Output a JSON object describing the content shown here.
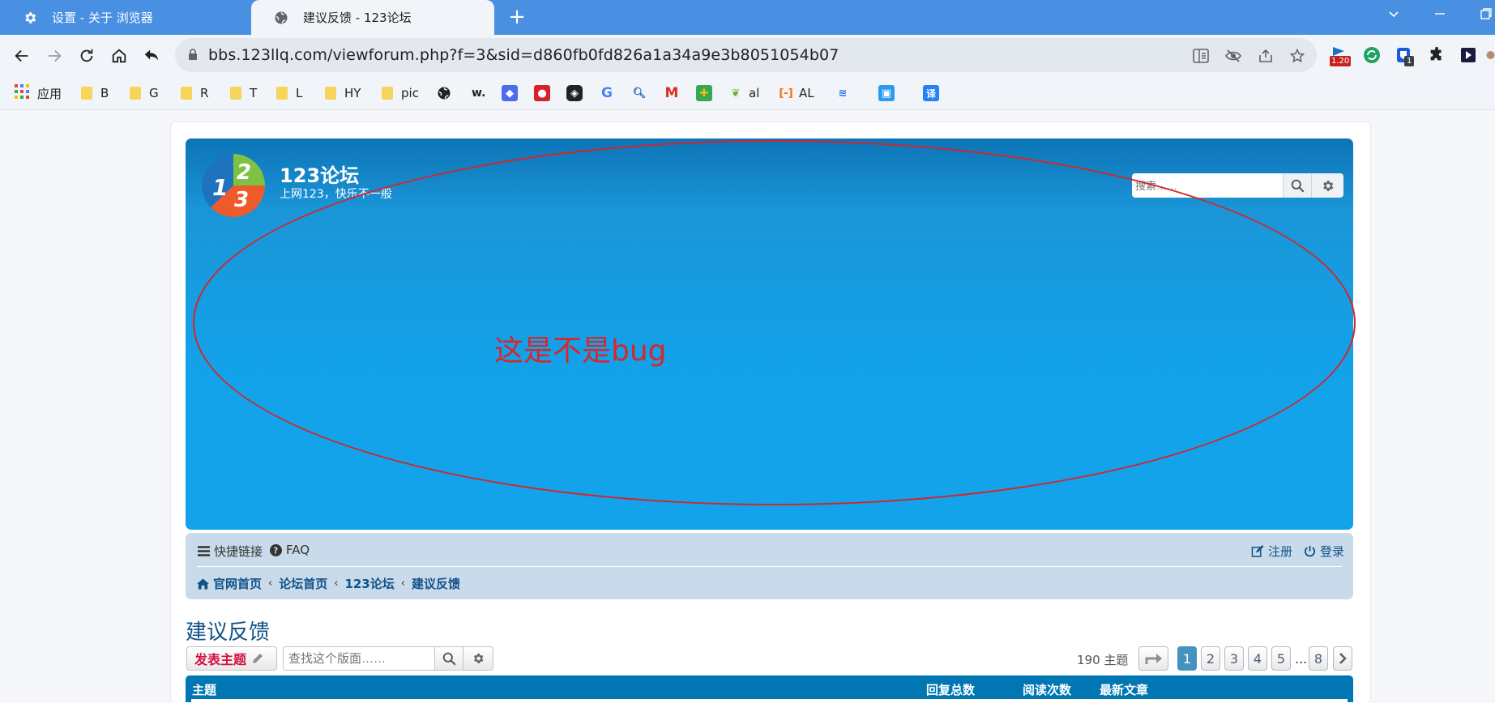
{
  "browser": {
    "tabs": [
      {
        "title": "设置 - 关于 浏览器",
        "icon": "gear-icon",
        "active": false
      },
      {
        "title": "建议反馈 - 123论坛",
        "icon": "globe-icon",
        "active": true
      }
    ],
    "url": "bbs.123llq.com/viewforum.php?f=3&sid=d860fb0fd826a1a34a9e3b8051054b07",
    "extension_badges": {
      "b1": "1.20",
      "b2": "1"
    },
    "bookmarks": [
      {
        "label": "应用",
        "icon": "apps-grid-icon"
      },
      {
        "label": "B",
        "icon": "folder-icon"
      },
      {
        "label": "G",
        "icon": "folder-icon"
      },
      {
        "label": "R",
        "icon": "folder-icon"
      },
      {
        "label": "T",
        "icon": "folder-icon"
      },
      {
        "label": "L",
        "icon": "folder-icon"
      },
      {
        "label": "HY",
        "icon": "folder-icon"
      },
      {
        "label": "pic",
        "icon": "folder-icon"
      },
      {
        "label": "w.",
        "icon": "text-icon"
      },
      {
        "label": "al",
        "icon": "leaf-icon"
      },
      {
        "label": "AL",
        "icon": "aliyun-icon"
      },
      {
        "label": "译",
        "icon": "translate-icon"
      }
    ]
  },
  "forum": {
    "site_title": "123论坛",
    "site_desc": "上网123，快乐不一般",
    "search_placeholder": "搜索……",
    "quicklinks": "快捷链接",
    "faq": "FAQ",
    "register": "注册",
    "login": "登录",
    "breadcrumbs": [
      "官网首页",
      "论坛首页",
      "123论坛",
      "建议反馈"
    ],
    "forum_title": "建议反馈",
    "new_topic": "发表主题",
    "forum_search_placeholder": "查找这个版面……",
    "topic_count": "190 主题",
    "pages": [
      "1",
      "2",
      "3",
      "4",
      "5",
      "...",
      "8"
    ],
    "columns": [
      "主题",
      "回复总数",
      "阅读次数",
      "最新文章"
    ],
    "logo_digits": [
      "1",
      "2",
      "3"
    ]
  },
  "annotation": {
    "text": "这是不是bug",
    "color": "#d8262b"
  },
  "colors": {
    "tabstrip": "#4a90e2",
    "header": "#12a3eb",
    "navbar": "#c9dbea",
    "link": "#105289",
    "table_header": "#0076b3",
    "new_topic": "#d31141"
  }
}
